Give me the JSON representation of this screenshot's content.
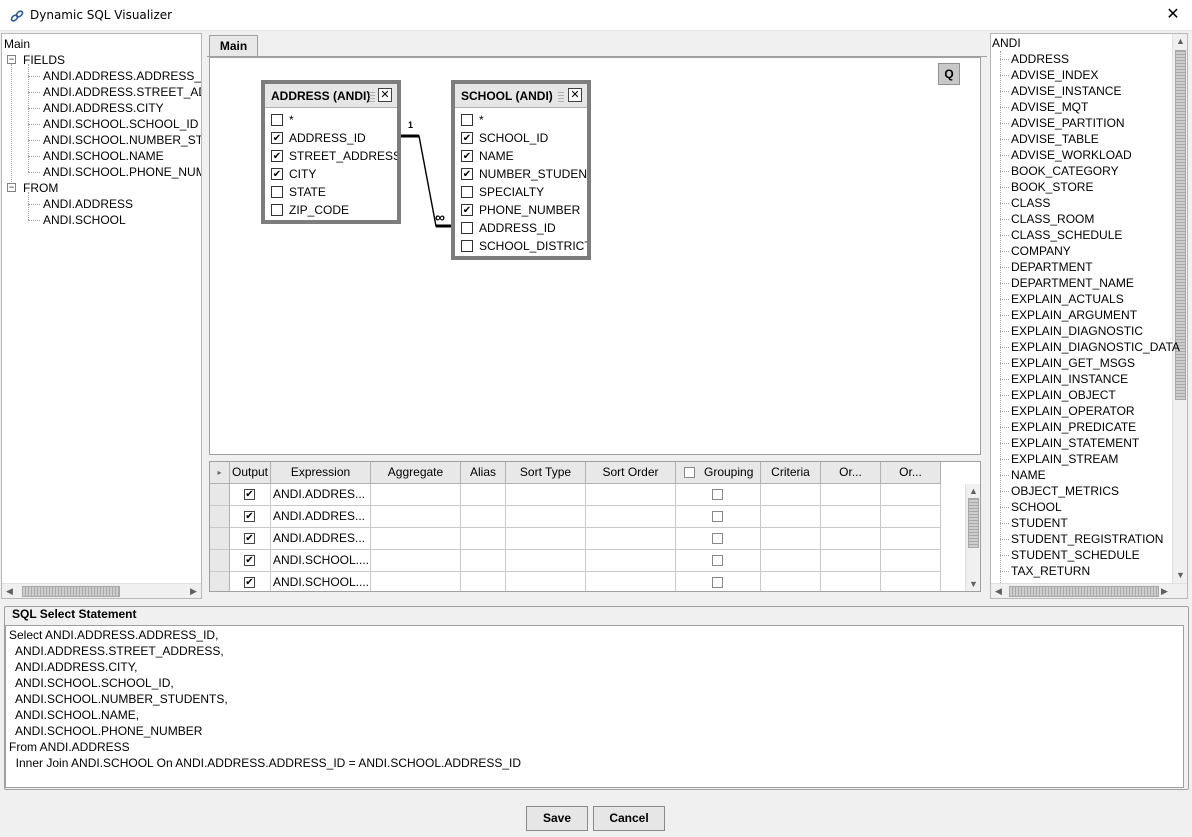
{
  "window": {
    "title": "Dynamic SQL Visualizer",
    "close_glyph": "✕"
  },
  "left_tree": {
    "root": "Main",
    "fields_label": "FIELDS",
    "fields": [
      "ANDI.ADDRESS.ADDRESS_ID",
      "ANDI.ADDRESS.STREET_ADDRESS",
      "ANDI.ADDRESS.CITY",
      "ANDI.SCHOOL.SCHOOL_ID",
      "ANDI.SCHOOL.NUMBER_STUDENTS",
      "ANDI.SCHOOL.NAME",
      "ANDI.SCHOOL.PHONE_NUMBER"
    ],
    "from_label": "FROM",
    "from": [
      "ANDI.ADDRESS",
      "ANDI.SCHOOL"
    ],
    "toggle_glyph": "−"
  },
  "center": {
    "tab_label": "Main",
    "query_button": "Q",
    "address_table": {
      "title": "ADDRESS (ANDI)",
      "close_glyph": "✕",
      "fields": [
        {
          "name": "*",
          "checked": false
        },
        {
          "name": "ADDRESS_ID",
          "checked": true
        },
        {
          "name": "STREET_ADDRESS",
          "checked": true
        },
        {
          "name": "CITY",
          "checked": true
        },
        {
          "name": "STATE",
          "checked": false
        },
        {
          "name": "ZIP_CODE",
          "checked": false
        }
      ]
    },
    "school_table": {
      "title": "SCHOOL (ANDI)",
      "close_glyph": "✕",
      "fields": [
        {
          "name": "*",
          "checked": false
        },
        {
          "name": "SCHOOL_ID",
          "checked": true
        },
        {
          "name": "NAME",
          "checked": true
        },
        {
          "name": "NUMBER_STUDENTS",
          "checked": true
        },
        {
          "name": "SPECIALTY",
          "checked": false
        },
        {
          "name": "PHONE_NUMBER",
          "checked": true
        },
        {
          "name": "ADDRESS_ID",
          "checked": false
        },
        {
          "name": "SCHOOL_DISTRICT",
          "checked": false
        }
      ]
    },
    "join": {
      "one_label": "1",
      "many_label": "∞"
    }
  },
  "grid": {
    "corner_glyph": "▸",
    "columns": [
      "Output",
      "Expression",
      "Aggregate",
      "Alias",
      "Sort Type",
      "Sort Order",
      "Grouping",
      "Criteria",
      "Or...",
      "Or..."
    ],
    "rows": [
      {
        "output": true,
        "expression": "ANDI.ADDRES...",
        "grouping": false
      },
      {
        "output": true,
        "expression": "ANDI.ADDRES...",
        "grouping": false
      },
      {
        "output": true,
        "expression": "ANDI.ADDRES...",
        "grouping": false
      },
      {
        "output": true,
        "expression": "ANDI.SCHOOL....",
        "grouping": false
      },
      {
        "output": true,
        "expression": "ANDI.SCHOOL....",
        "grouping": false
      }
    ]
  },
  "right_tree": {
    "root": "ANDI",
    "items": [
      "ADDRESS",
      "ADVISE_INDEX",
      "ADVISE_INSTANCE",
      "ADVISE_MQT",
      "ADVISE_PARTITION",
      "ADVISE_TABLE",
      "ADVISE_WORKLOAD",
      "BOOK_CATEGORY",
      "BOOK_STORE",
      "CLASS",
      "CLASS_ROOM",
      "CLASS_SCHEDULE",
      "COMPANY",
      "DEPARTMENT",
      "DEPARTMENT_NAME",
      "EXPLAIN_ACTUALS",
      "EXPLAIN_ARGUMENT",
      "EXPLAIN_DIAGNOSTIC",
      "EXPLAIN_DIAGNOSTIC_DATA",
      "EXPLAIN_GET_MSGS",
      "EXPLAIN_INSTANCE",
      "EXPLAIN_OBJECT",
      "EXPLAIN_OPERATOR",
      "EXPLAIN_PREDICATE",
      "EXPLAIN_STATEMENT",
      "EXPLAIN_STREAM",
      "NAME",
      "OBJECT_METRICS",
      "SCHOOL",
      "STUDENT",
      "STUDENT_REGISTRATION",
      "STUDENT_SCHEDULE",
      "TAX_RETURN"
    ]
  },
  "sql": {
    "legend": "SQL Select Statement",
    "lines": [
      "Select ANDI.ADDRESS.ADDRESS_ID,",
      "  ANDI.ADDRESS.STREET_ADDRESS,",
      "  ANDI.ADDRESS.CITY,",
      "  ANDI.SCHOOL.SCHOOL_ID,",
      "  ANDI.SCHOOL.NUMBER_STUDENTS,",
      "  ANDI.SCHOOL.NAME,",
      "  ANDI.SCHOOL.PHONE_NUMBER",
      "From ANDI.ADDRESS",
      "  Inner Join ANDI.SCHOOL On ANDI.ADDRESS.ADDRESS_ID = ANDI.SCHOOL.ADDRESS_ID"
    ]
  },
  "buttons": {
    "save": "Save",
    "cancel": "Cancel"
  },
  "scroll_glyphs": {
    "left": "◀",
    "right": "▶",
    "up": "▲",
    "down": "▼"
  }
}
